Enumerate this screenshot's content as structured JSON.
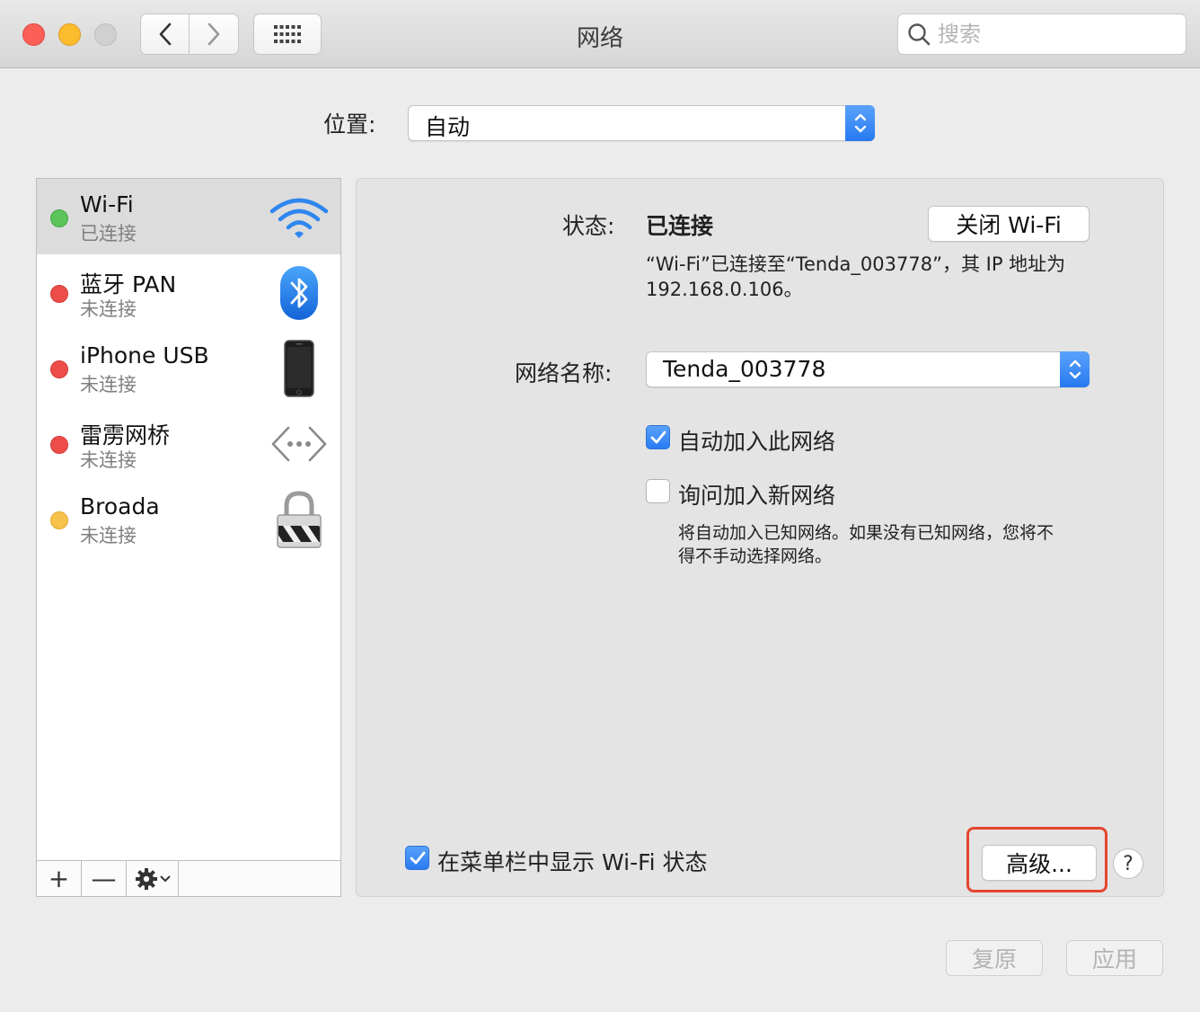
{
  "window": {
    "title": "网络"
  },
  "search": {
    "placeholder": "搜索"
  },
  "location": {
    "label": "位置:",
    "value": "自动"
  },
  "services": [
    {
      "name": "Wi-Fi",
      "status": "已连接",
      "status_color": "#5ac35a",
      "icon": "wifi-icon",
      "selected": true
    },
    {
      "name": "蓝牙 PAN",
      "status": "未连接",
      "status_color": "#ec4d49",
      "icon": "bluetooth-icon"
    },
    {
      "name": "iPhone USB",
      "status": "未连接",
      "status_color": "#ec4d49",
      "icon": "iphone-icon"
    },
    {
      "name": "雷雳网桥",
      "status": "未连接",
      "status_color": "#ec4d49",
      "icon": "thunderbolt-bridge-icon"
    },
    {
      "name": "Broada",
      "status": "未连接",
      "status_color": "#f7c24a",
      "icon": "vpn-lock-icon"
    }
  ],
  "sidebar_toolbar": {
    "add": "+",
    "remove": "—"
  },
  "detail": {
    "status_label": "状态:",
    "status_value": "已连接",
    "turn_off_button": "关闭 Wi-Fi",
    "status_desc_line1": "“Wi-Fi”已连接至“Tenda_003778”，其 IP 地址为",
    "status_desc_line2": "192.168.0.106。",
    "network_name_label": "网络名称:",
    "network_name_value": "Tenda_003778",
    "auto_join_label": "自动加入此网络",
    "auto_join_checked": true,
    "ask_join_label": "询问加入新网络",
    "ask_join_checked": false,
    "ask_desc_line1": "将自动加入已知网络。如果没有已知网络，您将不",
    "ask_desc_line2": "得不手动选择网络。",
    "show_menubar_label": "在菜单栏中显示 Wi-Fi 状态",
    "show_menubar_checked": true,
    "advanced_button": "高级...",
    "help_button": "?"
  },
  "footer": {
    "revert_button": "复原",
    "apply_button": "应用"
  },
  "colors": {
    "accent": "#2a7bf2",
    "highlight": "#e5462f"
  }
}
